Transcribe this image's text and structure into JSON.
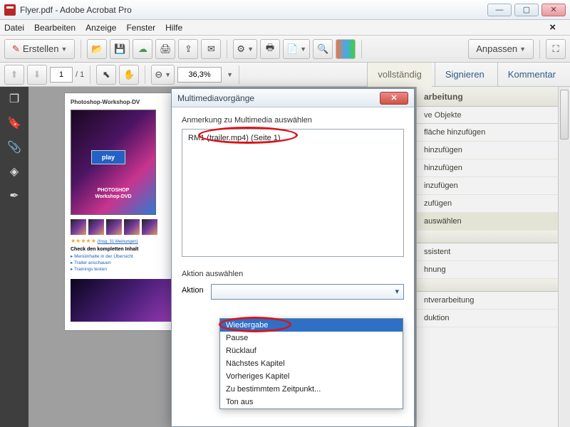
{
  "window": {
    "title": "Flyer.pdf - Adobe Acrobat Pro"
  },
  "menu": {
    "items": [
      "Datei",
      "Bearbeiten",
      "Anzeige",
      "Fenster",
      "Hilfe"
    ]
  },
  "toolbar1": {
    "create": "Erstellen",
    "customize": "Anpassen"
  },
  "toolbar2": {
    "page_current": "1",
    "page_total": "1",
    "zoom": "36,3%",
    "fullscreen": "vollständig",
    "sign": "Signieren",
    "comment": "Kommentar"
  },
  "document": {
    "title": "Photoshop-Workshop-DV",
    "play": "play",
    "dvd_label1": "PHOTOSHOP",
    "dvd_label2": "Workshop-DVD",
    "stars_link": "(Insg. 31 Meinungen)",
    "section": "Check den kompletten Inhalt",
    "links": [
      "Menüinhalte in der Übersicht",
      "Trailer anschauen",
      "Trainings testen"
    ]
  },
  "rightpanel": {
    "header": "arbeitung",
    "sub": "ve Objekte",
    "items": [
      "fläche hinzufügen",
      "hinzufügen",
      "hinzufügen",
      "inzufügen",
      "zufügen",
      "auswählen"
    ],
    "sel_index": 5,
    "section2": "",
    "item_a": "ssistent",
    "item_b": "hnung",
    "section3": "",
    "item_c": "ntverarbeitung",
    "item_d": "duktion"
  },
  "dialog": {
    "title": "Multimediavorgänge",
    "select_label": "Anmerkung zu Multimedia auswählen",
    "list_item": "RM1 (trailer.mp4) (Seite 1)",
    "action_label": "Aktion auswählen",
    "action_field": "Aktion",
    "options": [
      "Wiedergabe",
      "Pause",
      "Rücklauf",
      "Nächstes Kapitel",
      "Vorheriges Kapitel",
      "Zu bestimmtem Zeitpunkt...",
      "Ton aus"
    ],
    "selected_option": 0
  }
}
